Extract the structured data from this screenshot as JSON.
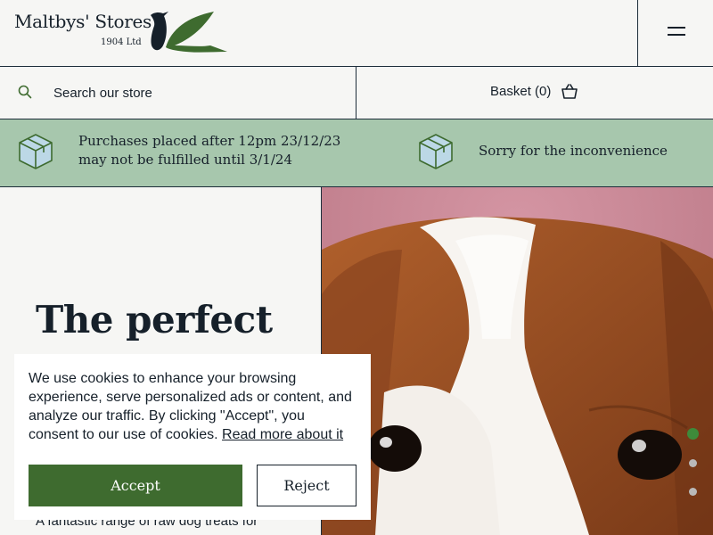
{
  "header": {
    "brand_name": "Maltbys' Stores",
    "brand_sub": "1904 Ltd",
    "logo_icon": "bird-logo-icon",
    "menu_icon": "hamburger-menu-icon"
  },
  "search": {
    "placeholder": "Search our store",
    "icon": "search-icon"
  },
  "basket": {
    "label": "Basket (0)",
    "icon": "basket-icon"
  },
  "notice": {
    "message_line1": "Purchases placed after 12pm 23/12/23",
    "message_line2": "may not be fulfilled until 3/1/24",
    "apology": "Sorry for the inconvenience",
    "icon": "package-box-icon"
  },
  "hero": {
    "title": "The perfect",
    "description": "A fantastic range of raw dog treats for",
    "image": "puppy-photo",
    "carousel_active_index": 0,
    "carousel_count": 3
  },
  "cookie": {
    "text": "We use cookies to enhance your browsing experience, serve personalized ads or content, and analyze our traffic. By clicking \"Accept\", you consent to our use of cookies.",
    "link_label": "Read more about it",
    "accept_label": "Accept",
    "reject_label": "Reject"
  },
  "colors": {
    "accent_green": "#3e6b2f",
    "banner_green": "#a7c7ad",
    "navy": "#16202a",
    "background": "#f6f6f4"
  }
}
